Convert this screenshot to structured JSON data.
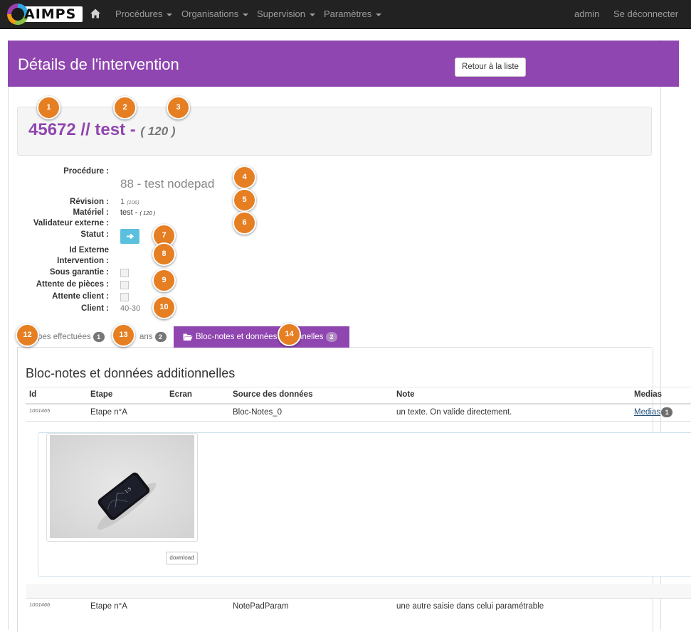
{
  "nav": {
    "logo_text": "AIMPS",
    "items": [
      {
        "label": "Procédures",
        "dropdown": true
      },
      {
        "label": "Organisations",
        "dropdown": true
      },
      {
        "label": "Supervision",
        "dropdown": true
      },
      {
        "label": "Paramètres",
        "dropdown": true
      }
    ],
    "user": "admin",
    "logout": "Se déconnecter",
    "home_icon": "home-icon"
  },
  "header": {
    "title": "Détails de l'intervention",
    "back_button": "Retour à la liste"
  },
  "intervention": {
    "title": "45672 // test -",
    "quantity": "( 120 )"
  },
  "details": {
    "procedure_label": "Procédure :",
    "procedure_value": "88 - test nodepad",
    "revision_label": "Révision :",
    "revision_value": "1",
    "revision_extra": "(106)",
    "materiel_label": "Matériel :",
    "materiel_value": "test -",
    "materiel_extra": "( 120 )",
    "validateur_label": "Validateur externe :",
    "statut_label": "Statut :",
    "id_externe_label_1": "Id Externe",
    "id_externe_label_2": "Intervention :",
    "sous_garantie_label": "Sous garantie :",
    "attente_pieces_label": "Attente de pièces :",
    "attente_client_label": "Attente client :",
    "client_label": "Client :",
    "client_value": "40-30"
  },
  "callouts": [
    "1",
    "2",
    "3",
    "4",
    "5",
    "6",
    "7",
    "8",
    "9",
    "10",
    "12",
    "13",
    "14"
  ],
  "tabs": [
    {
      "label": "pes effectuées",
      "badge": "1",
      "active": false
    },
    {
      "label": "ans",
      "badge": "2",
      "active": false
    },
    {
      "label": "Bloc-notes et données",
      "label_tail": "nnelles",
      "badge": "2",
      "active": true
    }
  ],
  "notes": {
    "title": "Bloc-notes et données additionnelles",
    "columns": [
      "Id",
      "Etape",
      "Ecran",
      "Source des données",
      "Note",
      "Medias"
    ],
    "rows": [
      {
        "id": "1001465",
        "etape": "Etape n°A",
        "ecran": "",
        "source": "Bloc-Notes_0",
        "note": "un texte. On valide directement.",
        "medias_label": "Medias",
        "medias_count": "1"
      },
      {
        "id": "1001466",
        "etape": "Etape n°A",
        "ecran": "",
        "source": "NotePadParam",
        "note": "une autre saisie dans celui paramétrable"
      }
    ],
    "download_label": "download"
  },
  "colors": {
    "navbar": "#222222",
    "accent_purple": "#9046b0",
    "callout_orange": "#e67e22",
    "status_blue": "#5bc0de"
  }
}
